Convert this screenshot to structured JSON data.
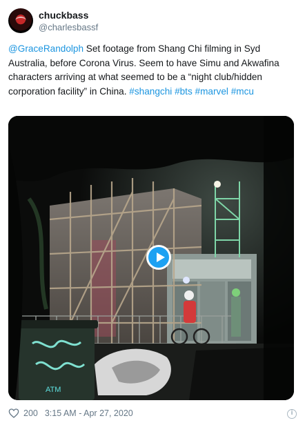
{
  "author": {
    "display_name": "chuckbass",
    "handle": "@charlesbassf"
  },
  "tweet": {
    "mention": "@GraceRandolph",
    "body": " Set footage from Shang Chi filming in Syd Australia, before Corona Virus. Seem to have Simu and Akwafina characters arriving at what seemed to be a “night club/hidden corporation facility” in China. ",
    "hashtags": [
      "#shangchi",
      "#bts",
      "#marvel",
      "#mcu"
    ]
  },
  "media": {
    "type": "video",
    "play_icon": "play-icon",
    "scene_text": "ATM"
  },
  "footer": {
    "like_icon": "heart-icon",
    "likes": "200",
    "timestamp": "3:15 AM - Apr 27, 2020",
    "info_icon": "info-icon"
  },
  "colors": {
    "link": "#1b95e0",
    "play_button": "#1da1f2",
    "muted": "#657786"
  }
}
